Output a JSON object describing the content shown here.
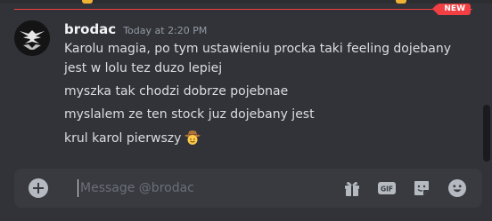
{
  "new_divider": {
    "badge": "NEW"
  },
  "message": {
    "username": "brodac",
    "timestamp": "Today at 2:20 PM",
    "lines": [
      "Karolu magia, po tym ustawieniu procka taki feeling dojebany jest w lolu tez duzo lepiej",
      "myszka tak chodzi dobrze pojebnae",
      "myslalem ze ten stock juz dojebany jest",
      "krul karol pierwszy"
    ],
    "emoji": "cowboy-face"
  },
  "composer": {
    "placeholder": "Message @brodac",
    "value": "",
    "icons": [
      "plus-circle-icon",
      "gift-icon",
      "gif-icon",
      "sticker-icon",
      "emoji-icon"
    ]
  },
  "colors": {
    "background": "#313338",
    "composer": "#383a40",
    "new_red": "#f23f43",
    "username": "#f2f3f5",
    "text": "#dbdee1",
    "muted": "#949ba4"
  }
}
